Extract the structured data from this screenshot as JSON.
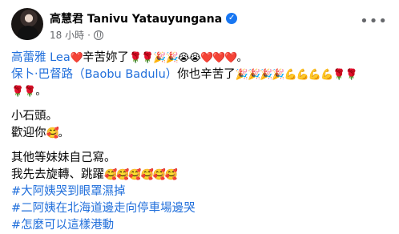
{
  "post": {
    "author": "高慧君 Tanivu Yatauyungana",
    "time": "18 小時",
    "mention_1": "高蕾雅 Lea",
    "line1_text": "辛苦妳了",
    "line1_emoji_a": "❤️",
    "line1_emoji_b": "🌹🌹🎉🎉😭😭❤️❤️❤️。",
    "mention_2": "保卜‧巴督路（Baobu Badulu）",
    "line2_text": "你也辛苦了",
    "line2_emoji": "🎉🎉🎉🎉💪💪💪💪🌹🌹",
    "line3_emoji": "🌹🌹。",
    "line4": "小石頭。",
    "line5_text": "歡迎你",
    "line5_emoji": "🥰。",
    "line6": "其他等妹妹自己寫。",
    "line7_text": "我先去旋轉、跳躍",
    "line7_emoji": "🥰🥰🥰🥰🥰🥰",
    "hashtags": [
      "#大阿姨哭到眼罩濕掉",
      "#二阿姨在北海道邊走向停車場邊哭",
      "#怎麼可以這樣港動"
    ]
  },
  "icons": {
    "verified": "verified-badge-icon",
    "globe": "globe-icon",
    "more": "more-options-icon"
  },
  "colors": {
    "link": "#216fdb",
    "verified": "#1877f2",
    "meta": "#65676b"
  }
}
